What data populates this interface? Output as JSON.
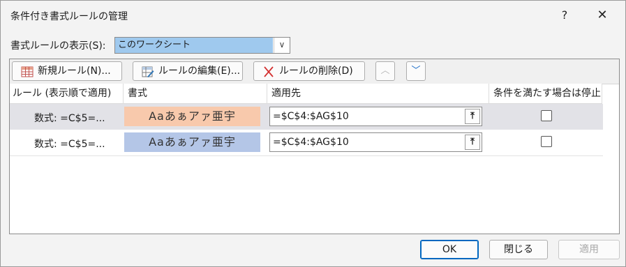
{
  "window": {
    "title": "条件付き書式ルールの管理",
    "help_glyph": "?",
    "close_glyph": "✕"
  },
  "scope": {
    "label": "書式ルールの表示(S):",
    "selected": "このワークシート"
  },
  "toolbar": {
    "new_rule": "新規ルール(N)...",
    "edit_rule": "ルールの編集(E)...",
    "delete_rule": "ルールの削除(D)",
    "up_glyph": "︿",
    "down_glyph": "﹀"
  },
  "columns": [
    "ルール (表示順で適用)",
    "書式",
    "適用先",
    "条件を満たす場合は停止"
  ],
  "rules": [
    {
      "rule": "数式: =C$5=...",
      "preview": "Aaあぁアァ亜宇",
      "preview_color": "#f8c9ac",
      "applies_to": "=$C$4:$AG$10",
      "stop_if_true": false
    },
    {
      "rule": "数式: =C$5=...",
      "preview": "Aaあぁアァ亜宇",
      "preview_color": "#b4c6e7",
      "applies_to": "=$C$4:$AG$10",
      "stop_if_true": false
    }
  ],
  "footer": {
    "ok": "OK",
    "close": "閉じる",
    "apply": "適用"
  },
  "colors": {
    "selection": "#9fc9ee",
    "selected_row": "#e2e2e7",
    "accent": "#0067c0"
  }
}
